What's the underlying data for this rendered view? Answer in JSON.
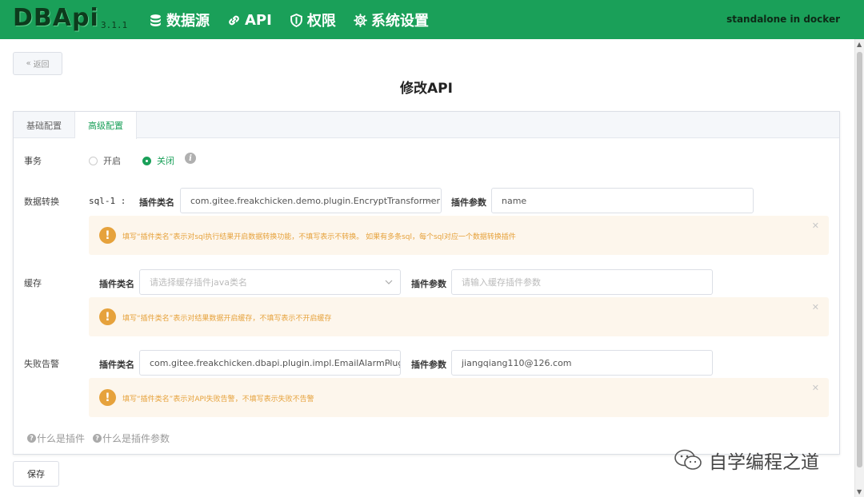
{
  "header": {
    "logo": "DBApi",
    "version": "3.1.1",
    "nav": [
      {
        "label": "数据源",
        "icon": "database-icon"
      },
      {
        "label": "API",
        "icon": "link-icon"
      },
      {
        "label": "权限",
        "icon": "shield-icon"
      },
      {
        "label": "系统设置",
        "icon": "gear-icon"
      }
    ],
    "environment": "standalone in docker",
    "bg_color": "#1aa059"
  },
  "back_button": "返回",
  "page_title": "修改API",
  "tabs": [
    {
      "label": "基础配置",
      "active": false
    },
    {
      "label": "高级配置",
      "active": true
    }
  ],
  "transaction": {
    "label": "事务",
    "options": [
      "开启",
      "关闭"
    ],
    "selected": "关闭"
  },
  "data_transform": {
    "label": "数据转换",
    "sql_prefix": "sql-1 :",
    "class_label": "插件类名",
    "class_value": "com.gitee.freakchicken.demo.plugin.EncryptTransformerP",
    "param_label": "插件参数",
    "param_value": "name",
    "tip": "填写“插件类名”表示对sql执行结果开启数据转换功能，不填写表示不转换。 如果有多条sql，每个sql对应一个数据转换插件"
  },
  "cache": {
    "label": "缓存",
    "class_label": "插件类名",
    "class_placeholder": "请选择缓存插件java类名",
    "param_label": "插件参数",
    "param_placeholder": "请输入缓存插件参数",
    "tip": "填写“插件类名”表示对结果数据开启缓存，不填写表示不开启缓存"
  },
  "alarm": {
    "label": "失败告警",
    "class_label": "插件类名",
    "class_value": "com.gitee.freakchicken.dbapi.plugin.impl.EmailAlarmPlugin",
    "param_label": "插件参数",
    "param_value": "jiangqiang110@126.com",
    "tip": "填写“插件类名”表示对API失败告警，不填写表示失败不告警"
  },
  "help_links": [
    "什么是插件",
    "什么是插件参数"
  ],
  "save_button": "保存",
  "watermark": "自学编程之道",
  "colors": {
    "accent": "#1aa059",
    "warning": "#e6a23c",
    "warning_bg": "#fdf6ec"
  }
}
